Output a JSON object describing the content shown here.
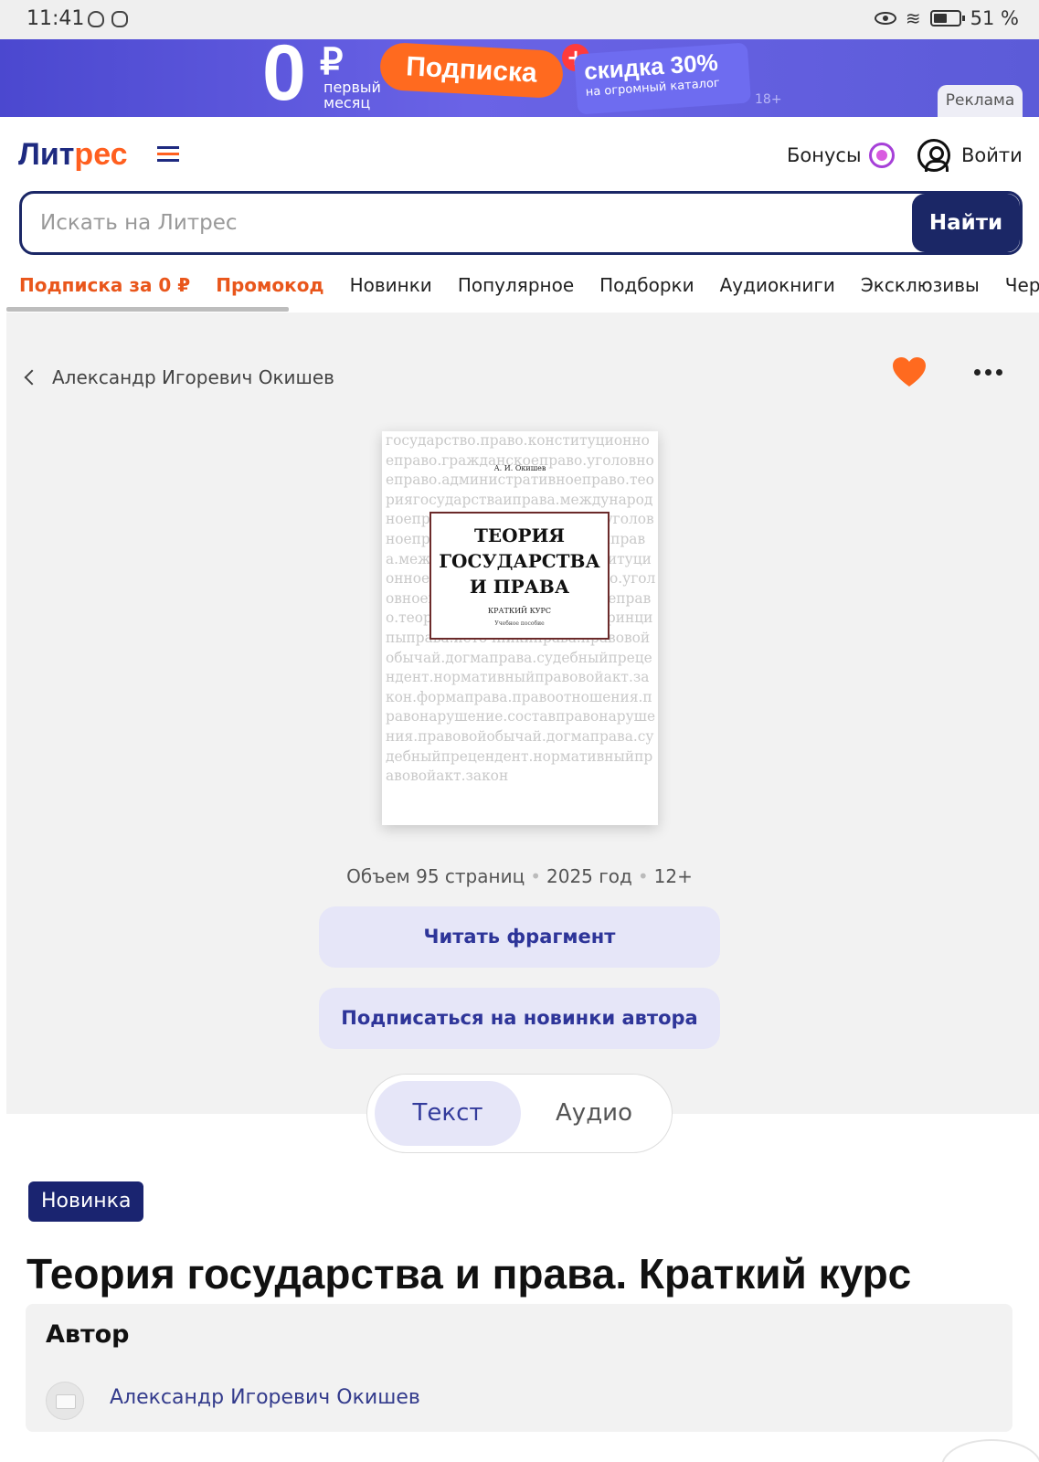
{
  "status_bar": {
    "time": "11:41",
    "battery": "51 %"
  },
  "ad": {
    "zero": "0",
    "currency": "₽",
    "first_month": "первый месяц",
    "subscription": "Подписка",
    "discount": "скидка 30%",
    "catalog": "на огромный каталог",
    "age": "18+",
    "label": "Реклама"
  },
  "header": {
    "logo_part1": "Лит",
    "logo_part2": "рес",
    "bonuses": "Бонусы",
    "login": "Войти"
  },
  "search": {
    "placeholder": "Искать на Литрес",
    "button": "Найти"
  },
  "nav": [
    {
      "label": "Подписка за 0 ₽"
    },
    {
      "label": "Промокод"
    },
    {
      "label": "Новинки"
    },
    {
      "label": "Популярное"
    },
    {
      "label": "Подборки"
    },
    {
      "label": "Аудиокниги"
    },
    {
      "label": "Эксклюзивы"
    },
    {
      "label": "Черновики"
    }
  ],
  "book": {
    "breadcrumb": "Александр Игоревич Окишев",
    "cover": {
      "author": "А. И. Окишев",
      "title": [
        "ТЕОРИЯ",
        "ГОСУДАРСТВА",
        "И ПРАВА"
      ],
      "subtitle": "КРАТКИЙ КУРС",
      "note": "Учебное пособие",
      "background_text": "государство.право.конституционноеправо.гражданскоеправо.уголовноеправо.административноеправо.теориягосударстваиправа.международноеправо.гражданскоеправо.уголовноеправо.теориягосударстваиправа.международноеправо.конституционноеправо.гражданскоеправо.уголовноеправо.административноеправо.теориягосударстваиправа.принципыправа.источникиправа.правовойобычай.догмаправа.судебныйпрецендент.нормативныйправовойакт.закон.формаправа.правоотношения.правонарушение.составправонарушения.правовойобычай.догмаправа.судебныйпрецендент.нормативныйправовойакт.закон"
    },
    "meta": {
      "pages": "Объем 95 страниц",
      "year": "2025 год",
      "age": "12+"
    },
    "read_button": "Читать фрагмент",
    "subscribe_button": "Подписаться на новинки автора",
    "tabs": {
      "text": "Текст",
      "audio": "Аудио"
    },
    "badge": "Новинка",
    "title": "Теория государства и права. Краткий курс",
    "author_header": "Автор",
    "author_name": "Александр Игоревич Окишев"
  },
  "colors": {
    "brand_blue": "#1b2766",
    "brand_orange": "#ff5f1f",
    "heart": "#ff6a1f"
  }
}
